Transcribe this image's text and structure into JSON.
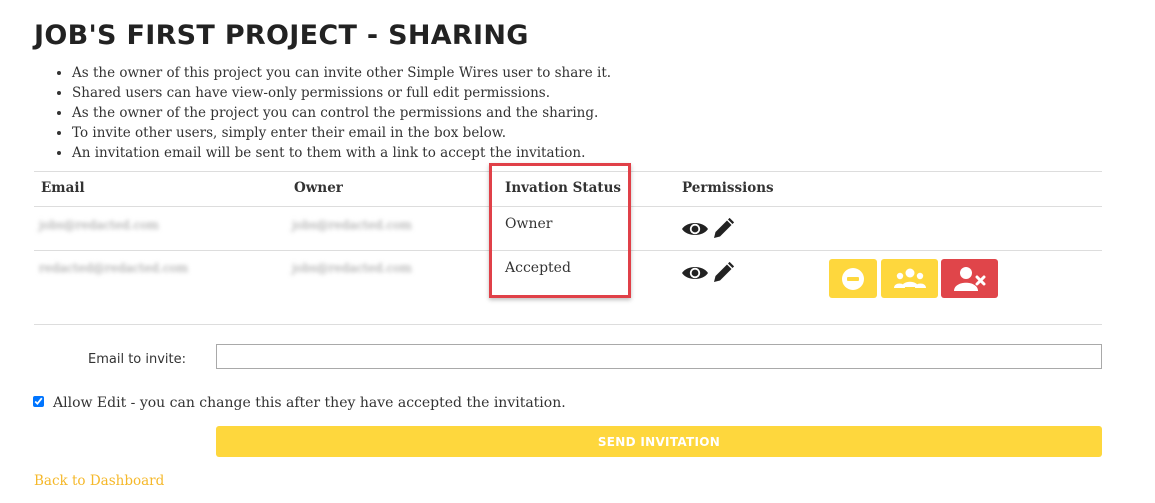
{
  "page": {
    "title": "JOB'S FIRST PROJECT - SHARING",
    "bullets": [
      "As the owner of this project you can invite other Simple Wires user to share it.",
      "Shared users can have view-only permissions or full edit permissions.",
      "As the owner of the project you can control the permissions and the sharing.",
      "To invite other users, simply enter their email in the box below.",
      "An invitation email will be sent to them with a link to accept the invitation."
    ]
  },
  "table": {
    "headers": [
      "Email",
      "Owner",
      "Invation Status",
      "Permissions"
    ],
    "rows": [
      {
        "email": "jobs@redacted.com",
        "owner": "jobs@redacted.com",
        "status": "Owner",
        "permission_icons": [
          "eye-icon",
          "pencil-icon"
        ]
      },
      {
        "email": "redacted@redacted.com",
        "owner": "jobs@redacted.com",
        "status": "Accepted",
        "permission_icons": [
          "eye-icon",
          "pencil-icon"
        ],
        "actions": [
          {
            "name": "revoke-button",
            "icon": "minus-circle-icon",
            "color": "#fed73d"
          },
          {
            "name": "group-permissions-button",
            "icon": "users-icon",
            "color": "#fed73d"
          },
          {
            "name": "remove-user-button",
            "icon": "user-remove-icon",
            "color": "#e0454a"
          }
        ]
      }
    ]
  },
  "form": {
    "email_label": "Email to invite:",
    "email_value": "",
    "allow_edit_checked": true,
    "allow_edit_label": "Allow Edit - you can change this after they have accepted the invitation.",
    "send_label": "SEND INVITATION"
  },
  "nav": {
    "back_label": "Back to Dashboard"
  },
  "colors": {
    "accent": "#fed73d",
    "danger": "#e0454a",
    "highlight": "#e04048",
    "link": "#f5b82a"
  }
}
